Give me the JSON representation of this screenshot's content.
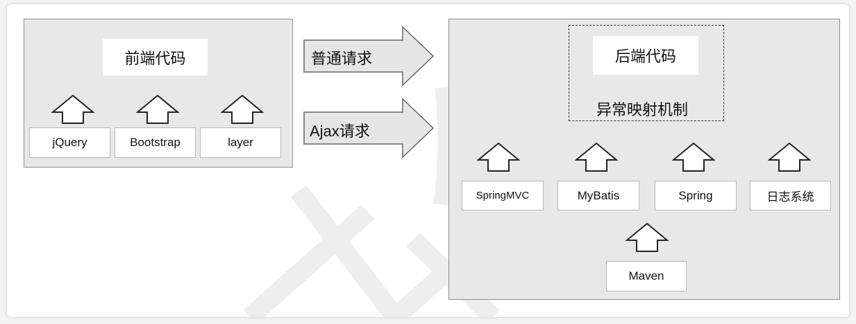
{
  "frontend": {
    "title": "前端代码",
    "libs": [
      "jQuery",
      "Bootstrap",
      "layer"
    ]
  },
  "requests": {
    "normal": "普通请求",
    "ajax": "Ajax请求"
  },
  "backend": {
    "title": "后端代码",
    "exception": "异常映射机制",
    "libs": [
      "SpringMVC",
      "MyBatis",
      "Spring",
      "日志系统"
    ],
    "build": "Maven"
  }
}
